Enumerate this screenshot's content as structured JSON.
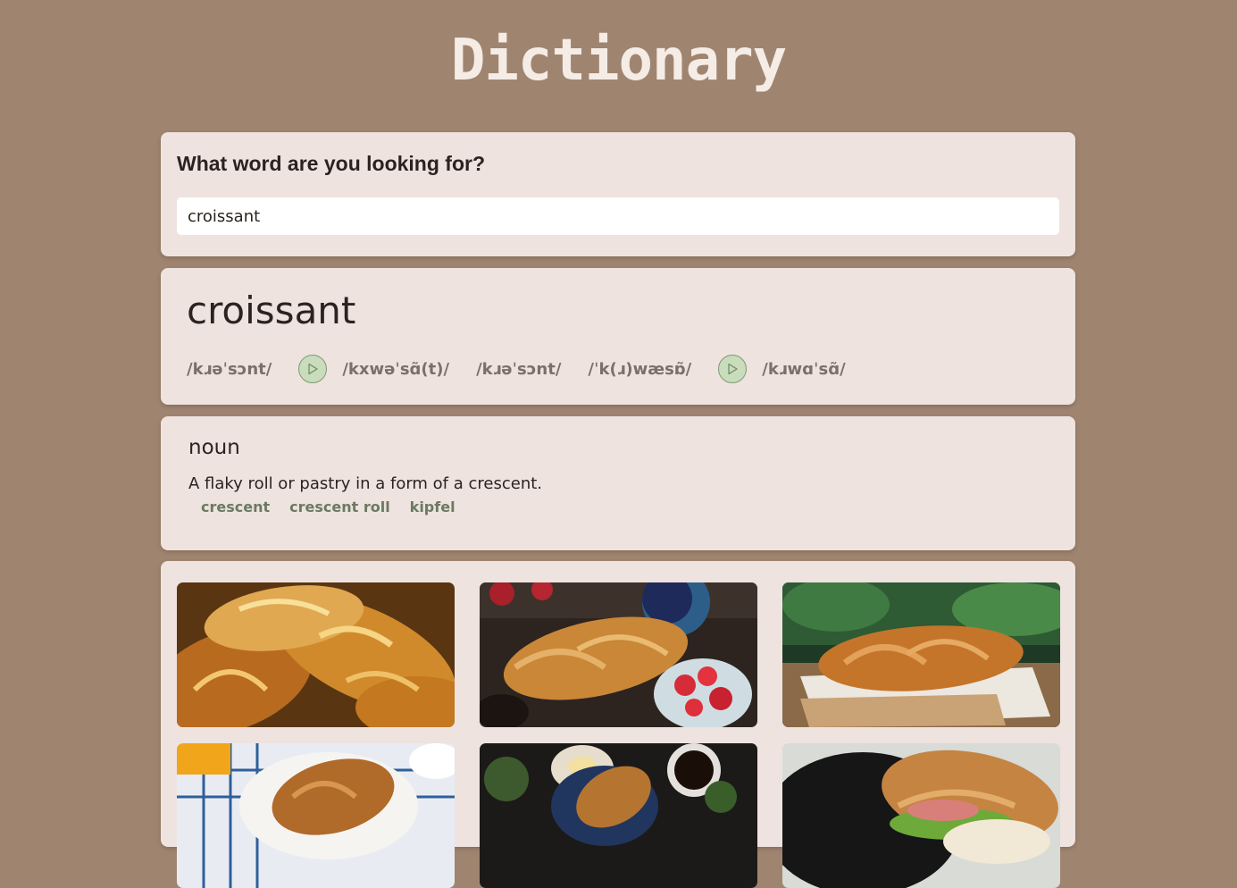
{
  "app": {
    "title": "Dictionary"
  },
  "search": {
    "heading": "What word are you looking for?",
    "value": "croissant"
  },
  "word": {
    "headword": "croissant",
    "phonetics": [
      {
        "text": "/kɹəˈsɔnt/",
        "has_audio": false
      },
      {
        "text": "/kxwəˈsɑ̃(t)/",
        "has_audio": true
      },
      {
        "text": "/kɹəˈsɔnt/",
        "has_audio": false
      },
      {
        "text": "/ˈk(ɹ)wæsɒ̃/",
        "has_audio": false
      },
      {
        "text": "/kɹwɑˈsɑ̃/",
        "has_audio": true
      }
    ]
  },
  "meaning": {
    "part_of_speech": "noun",
    "definition": "A flaky roll or pastry in a form of a crescent.",
    "synonyms": [
      "crescent",
      "crescent roll",
      "kipfel"
    ]
  },
  "photos": [
    {
      "subject": "croissants-closeup"
    },
    {
      "subject": "croissant-with-berries"
    },
    {
      "subject": "croissant-on-board"
    },
    {
      "subject": "croissants-with-juice"
    },
    {
      "subject": "croissant-with-coffee"
    },
    {
      "subject": "croissant-sandwich"
    }
  ],
  "colors": {
    "background": "#9f8570",
    "card": "#eee3df",
    "play_button": "#c9dcbc",
    "synonym": "#6b7a62",
    "phonetic": "#7c6f6a"
  }
}
